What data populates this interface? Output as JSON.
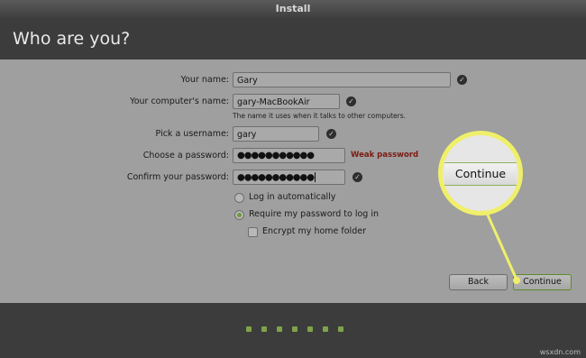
{
  "window": {
    "title": "Install"
  },
  "header": {
    "title": "Who are you?"
  },
  "form": {
    "name_label": "Your name:",
    "name_value": "Gary",
    "computer_label": "Your computer's name:",
    "computer_value": "gary-MacBookAir",
    "computer_hint": "The name it uses when it talks to other computers.",
    "username_label": "Pick a username:",
    "username_value": "gary",
    "password_label": "Choose a password:",
    "password_value": "●●●●●●●●●●●",
    "password_strength": "Weak password",
    "confirm_label": "Confirm your password:",
    "confirm_value": "●●●●●●●●●●●",
    "login_auto": "Log in automatically",
    "login_require": "Require my password to log in",
    "encrypt_home": "Encrypt my home folder"
  },
  "buttons": {
    "back": "Back",
    "continue": "Continue"
  },
  "zoom_callout": {
    "label": "Continue"
  },
  "progress": {
    "steps_total": 7
  },
  "watermark": "wsxdn.com",
  "colors": {
    "accent_green": "#7fa34a",
    "callout_yellow": "#f0ef6a",
    "weak_red": "#7a1b12"
  }
}
